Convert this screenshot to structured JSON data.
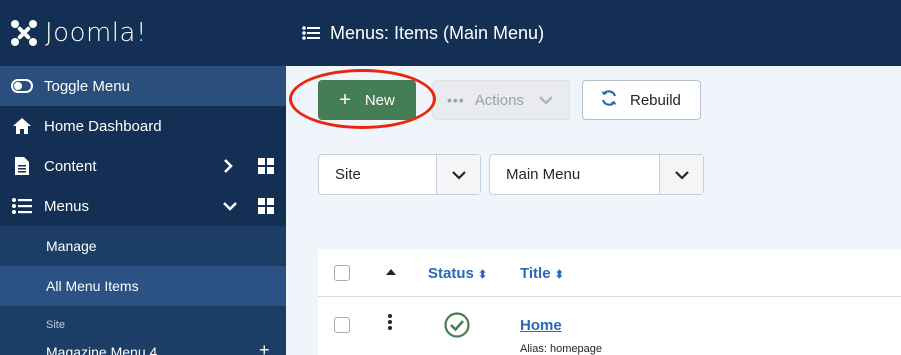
{
  "brand": {
    "name": "Joomla!"
  },
  "sidebar": {
    "toggle_label": "Toggle Menu",
    "items": [
      {
        "label": "Home Dashboard"
      },
      {
        "label": "Content"
      },
      {
        "label": "Menus"
      }
    ],
    "submenu": {
      "manage": "Manage",
      "all_items": "All Menu Items",
      "heading": "Site",
      "magazine": "Magazine Menu 4"
    }
  },
  "header": {
    "title": "Menus: Items (Main Menu)"
  },
  "toolbar": {
    "new_label": "New",
    "actions_label": "Actions",
    "rebuild_label": "Rebuild"
  },
  "filters": {
    "client": "Site",
    "menu": "Main Menu"
  },
  "table": {
    "columns": {
      "status": "Status",
      "title": "Title"
    },
    "rows": [
      {
        "title": "Home",
        "alias": "Alias: homepage"
      }
    ]
  },
  "colors": {
    "sidebar_bg": "#132f53",
    "accent_green": "#457d54",
    "link_blue": "#2a69b8",
    "highlight_red": "#e8270d"
  }
}
